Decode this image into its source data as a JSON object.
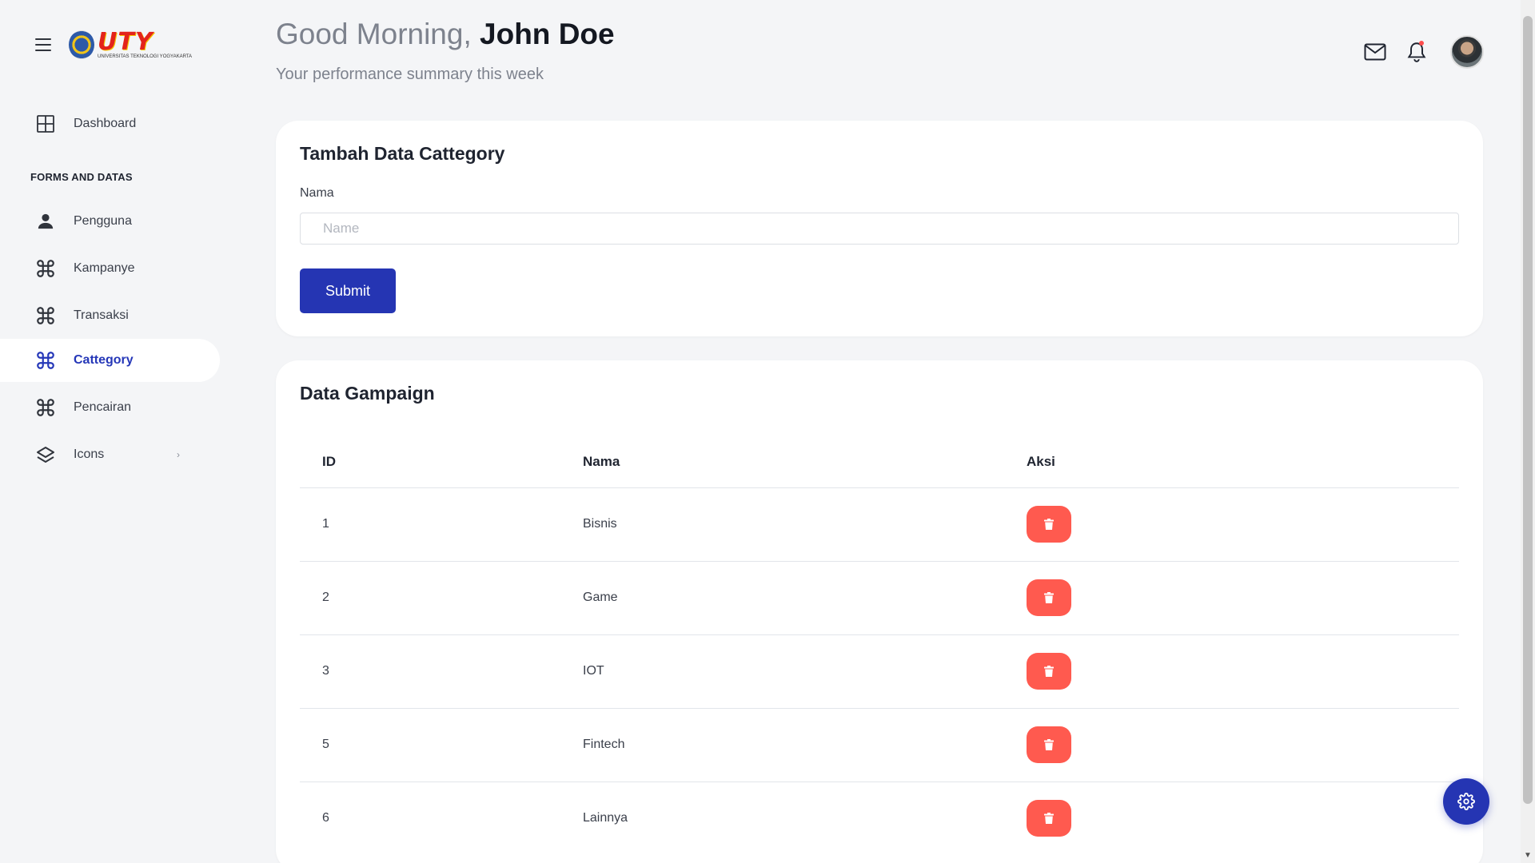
{
  "brand": {
    "logo_text": "UTY",
    "logo_subtitle": "UNIVERSITAS TEKNOLOGI YOGYAKARTA"
  },
  "sidebar": {
    "items": [
      {
        "label": "Dashboard",
        "icon": "grid-icon"
      },
      {
        "label": "Pengguna",
        "icon": "user-icon"
      },
      {
        "label": "Kampanye",
        "icon": "command-icon"
      },
      {
        "label": "Transaksi",
        "icon": "command-icon"
      },
      {
        "label": "Cattegory",
        "icon": "command-icon",
        "active": true
      },
      {
        "label": "Pencairan",
        "icon": "command-icon"
      },
      {
        "label": "Icons",
        "icon": "layers-icon"
      }
    ],
    "section_heading": "FORMS AND DATAS"
  },
  "header": {
    "greeting_prefix": "Good Morning,",
    "user_name": "John Doe",
    "subtitle": "Your performance summary this week"
  },
  "form": {
    "title": "Tambah Data Cattegory",
    "field_label": "Nama",
    "placeholder": "Name",
    "value": "",
    "submit_label": "Submit"
  },
  "table": {
    "title": "Data Gampaign",
    "headers": [
      "ID",
      "Nama",
      "Aksi"
    ],
    "rows": [
      {
        "id": "1",
        "nama": "Bisnis"
      },
      {
        "id": "2",
        "nama": "Game"
      },
      {
        "id": "3",
        "nama": "IOT"
      },
      {
        "id": "5",
        "nama": "Fintech"
      },
      {
        "id": "6",
        "nama": "Lainnya"
      }
    ]
  },
  "colors": {
    "primary": "#2535b3",
    "danger": "#ff5a4f",
    "background": "#f4f5f7"
  }
}
